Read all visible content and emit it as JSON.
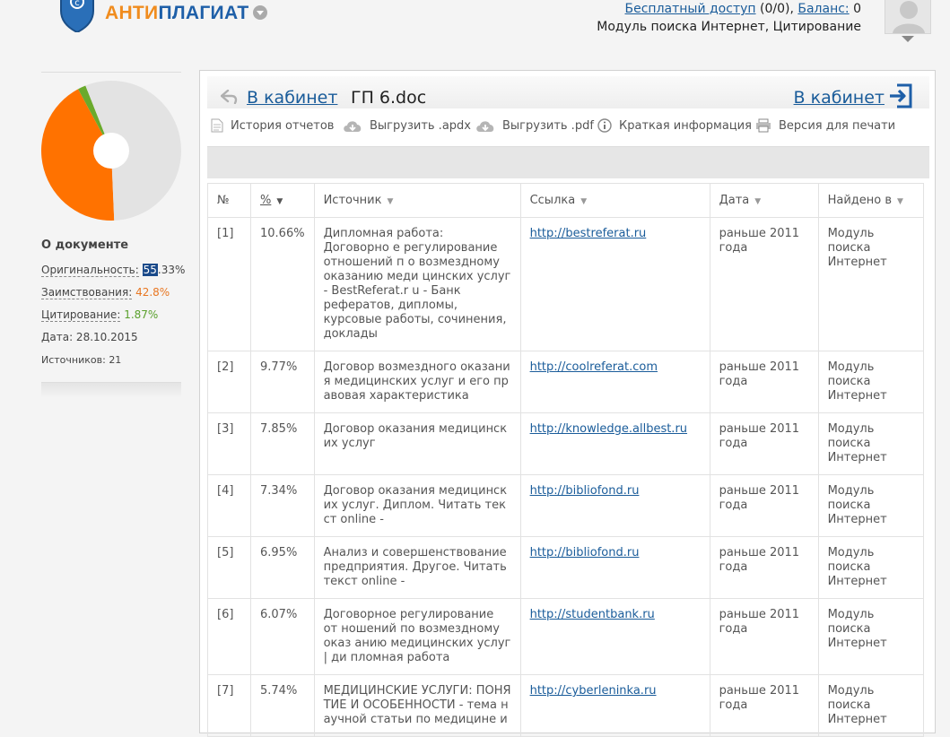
{
  "header": {
    "logo_part1": "АНТИ",
    "logo_part2": "ПЛАГИАТ",
    "free_access_link": "Бесплатный доступ",
    "free_access_count": " (0/0), ",
    "balance_link": "Баланс:",
    "balance_value": " 0",
    "modules_line": "Модуль поиска Интернет, Цитирование"
  },
  "colors": {
    "brand_orange": "#f08c1e",
    "brand_blue": "#1e5fa8",
    "borrowed": "#ff7200",
    "original": "#e3e3e3",
    "citation": "#6aaa2c"
  },
  "sidebar": {
    "section_title": "О документе",
    "originality_label": "Оригинальность:",
    "originality_value_highlight": "55",
    "originality_value_rest": ".33%",
    "borrowing_label": "Заимствования:",
    "borrowing_value": "42.8%",
    "citation_label": "Цитирование:",
    "citation_value": "1.87%",
    "date_text": "Дата: 28.10.2015",
    "sources_text": "Источников: 21",
    "pie": {
      "original": 55.33,
      "borrowed": 42.8,
      "citation": 1.87
    }
  },
  "panel": {
    "back_link": "В кабинет",
    "document_name": "ГП 6.doc",
    "cabinet_link_right": "В кабинет",
    "toolbar": {
      "history": "История отчетов",
      "export_apdx": "Выгрузить .apdx",
      "export_pdf": "Выгрузить .pdf",
      "brief_info": "Краткая информация",
      "print_version": "Версия для печати"
    }
  },
  "table": {
    "headers": {
      "num": "№",
      "percent": "%",
      "source": "Источник",
      "link": "Ссылка",
      "date": "Дата",
      "found_in": "Найдено в"
    },
    "rows": [
      {
        "num": "[1]",
        "pct": "10.66%",
        "source": "Дипломная работа: Договорно е регулирование отношений п о возмездному оказанию меди цинских услуг - BestReferat.r u - Банк рефератов, дипломы, курсовые работы, сочинения, доклады",
        "url": "http://bestreferat.ru",
        "date": "раньше 2011 года",
        "found": "Модуль поиска Интернет"
      },
      {
        "num": "[2]",
        "pct": "9.77%",
        "source": "Договор возмездного оказани я медицинских услуг и его пр авовая характеристика",
        "url": "http://coolreferat.com",
        "date": "раньше 2011 года",
        "found": "Модуль поиска Интернет"
      },
      {
        "num": "[3]",
        "pct": "7.85%",
        "source": "Договор оказания медицинск их услуг",
        "url": "http://knowledge.allbest.ru",
        "date": "раньше 2011 года",
        "found": "Модуль поиска Интернет"
      },
      {
        "num": "[4]",
        "pct": "7.34%",
        "source": "Договор оказания медицинск их услуг. Диплом. Читать тек ст online -",
        "url": "http://bibliofond.ru",
        "date": "раньше 2011 года",
        "found": "Модуль поиска Интернет"
      },
      {
        "num": "[5]",
        "pct": "6.95%",
        "source": "Анализ и совершенствование предприятия. Другое. Читать текст online -",
        "url": "http://bibliofond.ru",
        "date": "раньше 2011 года",
        "found": "Модуль поиска Интернет"
      },
      {
        "num": "[6]",
        "pct": "6.07%",
        "source": "Договорное регулирование от ношений по возмездному оказ анию медицинских услуг | ди пломная работа",
        "url": "http://studentbank.ru",
        "date": "раньше 2011 года",
        "found": "Модуль поиска Интернет"
      },
      {
        "num": "[7]",
        "pct": "5.74%",
        "source": "МЕДИЦИНСКИЕ УСЛУГИ: ПОНЯ ТИЕ И ОСОБЕННОСТИ - тема н аучной статьи по медицине и",
        "url": "http://cyberleninka.ru",
        "date": "раньше 2011 года",
        "found": "Модуль поиска Интернет"
      }
    ]
  }
}
